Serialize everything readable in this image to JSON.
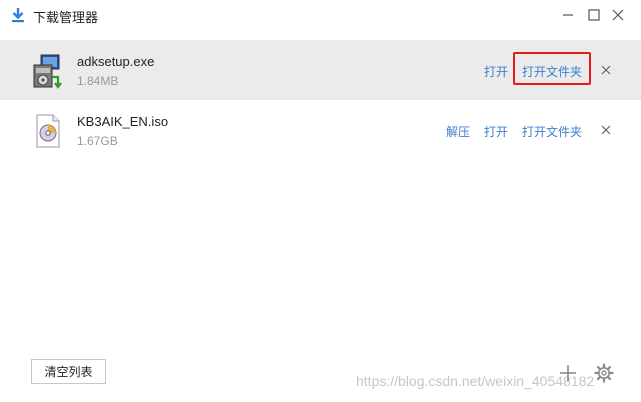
{
  "window": {
    "title": "下载管理器",
    "icons": {
      "app": "download-arrow-icon",
      "minimize": "minimize-icon",
      "maximize": "maximize-icon",
      "close": "close-icon"
    }
  },
  "downloads": [
    {
      "name": "adksetup.exe",
      "size": "1.84MB",
      "icon": "installer-file-icon",
      "selected": true,
      "actions": {
        "open": "打开",
        "open_folder": "打开文件夹"
      },
      "highlighted_action": "open_folder"
    },
    {
      "name": "KB3AIK_EN.iso",
      "size": "1.67GB",
      "icon": "disc-image-file-icon",
      "selected": false,
      "actions": {
        "extract": "解压",
        "open": "打开",
        "open_folder": "打开文件夹"
      }
    }
  ],
  "footer": {
    "clear_list": "清空列表",
    "add_icon": "plus-icon",
    "settings_icon": "gear-icon"
  },
  "watermark": "https://blog.csdn.net/weixin_40548182",
  "colors": {
    "link": "#3b7fd0",
    "highlight_border": "#e0201c",
    "selected_row": "#ebebeb",
    "title_icon": "#2f7fd6"
  }
}
